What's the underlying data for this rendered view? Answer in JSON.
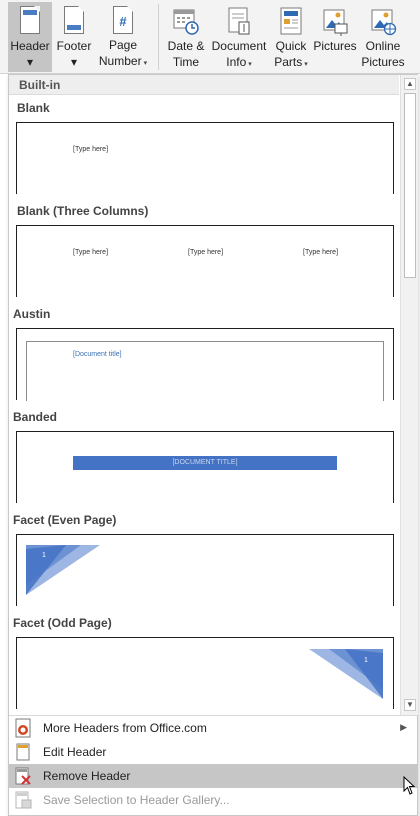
{
  "ribbon": {
    "header": {
      "line1": "Header",
      "caret": "▾"
    },
    "footer": {
      "line1": "Footer",
      "caret": "▾"
    },
    "page_number": {
      "line1": "Page",
      "line2": "Number",
      "caret": "▾"
    },
    "date_time": {
      "line1": "Date &",
      "line2": "Time"
    },
    "document_info": {
      "line1": "Document",
      "line2": "Info",
      "caret": "▾"
    },
    "quick_parts": {
      "line1": "Quick",
      "line2": "Parts",
      "caret": "▾"
    },
    "pictures": {
      "line1": "Pictures"
    },
    "online_pictures": {
      "line1": "Online",
      "line2": "Pictures"
    }
  },
  "gallery": {
    "group_label": "Built-in",
    "sections": [
      {
        "title": "Blank",
        "placeholders": [
          "[Type here]"
        ]
      },
      {
        "title": "Blank (Three Columns)",
        "placeholders": [
          "[Type here]",
          "[Type here]",
          "[Type here]"
        ]
      },
      {
        "title": "Austin",
        "placeholders": [
          "[Document title]"
        ]
      },
      {
        "title": "Banded",
        "placeholders": [
          "[DOCUMENT TITLE]"
        ]
      },
      {
        "title": "Facet (Even Page)",
        "placeholders": [
          "1"
        ]
      },
      {
        "title": "Facet (Odd Page)",
        "placeholders": [
          "1"
        ]
      }
    ],
    "accent_color": "#4472c4"
  },
  "menu": {
    "items": [
      {
        "label": "More Headers from Office.com",
        "icon": "office-icon",
        "has_submenu": true
      },
      {
        "label": "Edit Header",
        "icon": "edit-header-icon"
      },
      {
        "label": "Remove Header",
        "icon": "remove-header-icon",
        "highlighted": true
      },
      {
        "label": "Save Selection to Header Gallery...",
        "icon": "save-selection-icon",
        "disabled": true
      }
    ]
  }
}
